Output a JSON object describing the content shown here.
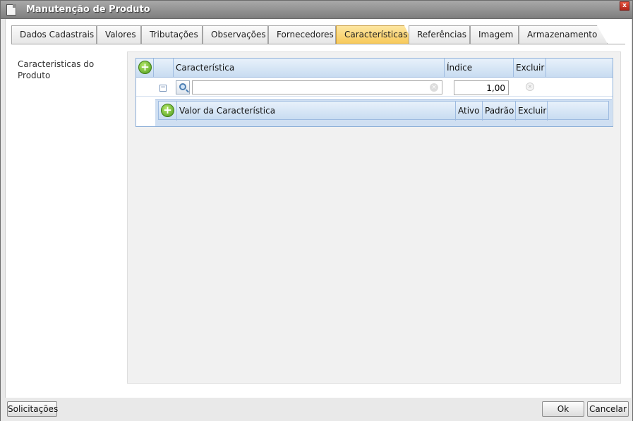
{
  "window": {
    "title": "Manutenção de Produto",
    "close_label": "x"
  },
  "tabs": [
    {
      "label": "Dados Cadastrais"
    },
    {
      "label": "Valores"
    },
    {
      "label": "Tributações"
    },
    {
      "label": "Observações"
    },
    {
      "label": "Fornecedores"
    },
    {
      "label": "Características",
      "active": true
    },
    {
      "label": "Referências"
    },
    {
      "label": "Imagem"
    },
    {
      "label": "Armazenamento"
    }
  ],
  "section": {
    "label": "Caracteristicas do Produto"
  },
  "grid": {
    "add_label": "+",
    "columns": {
      "caracteristica": "Característica",
      "indice": "Índice",
      "excluir": "Excluir"
    },
    "row": {
      "caracteristica": "",
      "indice": "1,00",
      "expand_label": "−",
      "delete_label": "×",
      "clear_label": "×"
    }
  },
  "subgrid": {
    "add_label": "+",
    "columns": {
      "valor": "Valor da Característica",
      "ativo": "Ativo",
      "padrao": "Padrão",
      "excluir": "Excluir"
    }
  },
  "footer": {
    "solicitacoes": "Solicitações",
    "ok": "Ok",
    "cancelar": "Cancelar"
  }
}
